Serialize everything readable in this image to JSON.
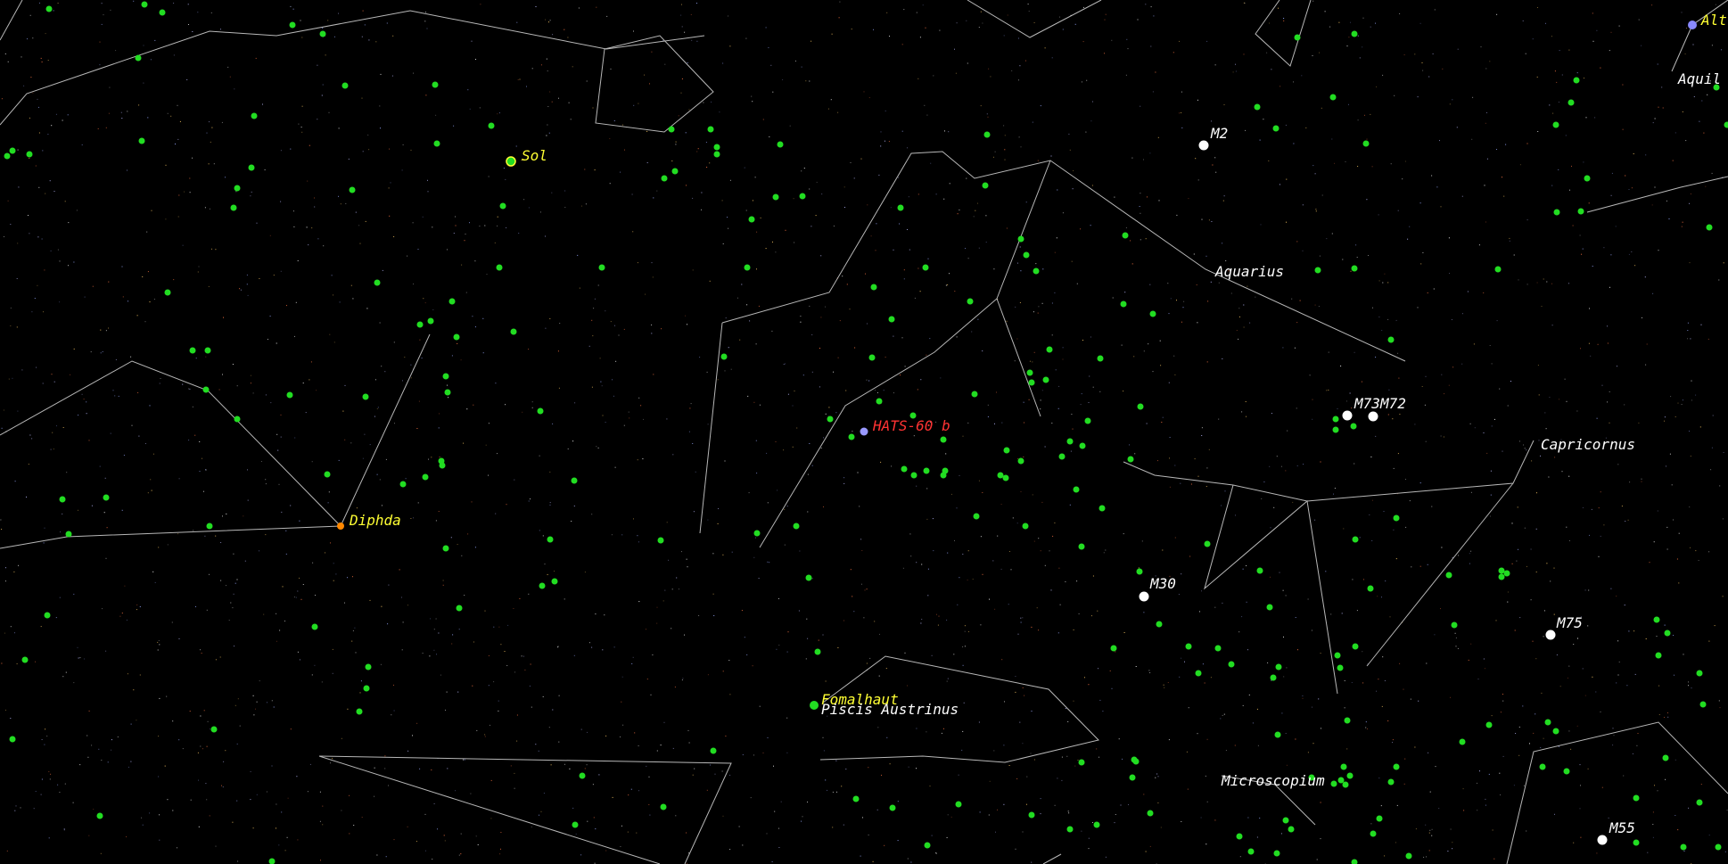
{
  "colors": {
    "background": "#000000",
    "constellation_line": "#d8d8d8",
    "green_star": "#22dd22",
    "named_star_label": "#ffff33",
    "exoplanet_label": "#ff3333",
    "dso_label": "#ffffff",
    "constellation_label": "#ffffff"
  },
  "labels": {
    "sol": "Sol",
    "diphda": "Diphda",
    "fomalhaut": "Fomalhaut",
    "altair": "Alt",
    "hats60b": "HATS-60 b",
    "m2": "M2",
    "m73": "M73",
    "m72": "M72",
    "m30": "M30",
    "m75": "M75",
    "m55": "M55",
    "aquarius": "Aquarius",
    "capricornus": "Capricornus",
    "piscis_austrinus": "Piscis Austrinus",
    "microscopium": "Microscopium",
    "aquila": "Aquil"
  }
}
